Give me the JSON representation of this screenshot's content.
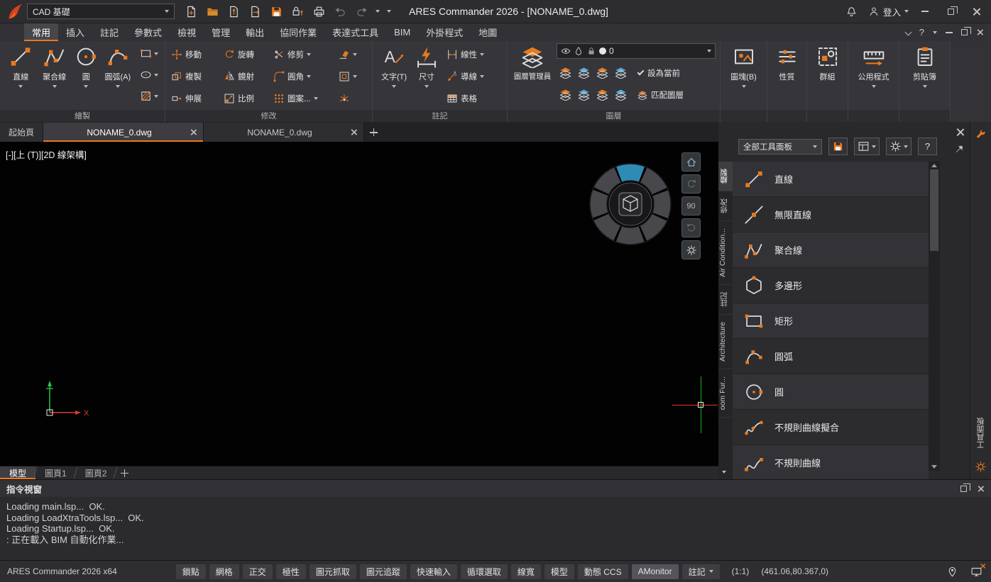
{
  "titlebar": {
    "workspace": "CAD 基礎",
    "title": "ARES Commander 2026 - [NONAME_0.dwg]",
    "login": "登入"
  },
  "menubar": {
    "tabs": [
      "常用",
      "插入",
      "註記",
      "參數式",
      "檢視",
      "管理",
      "輸出",
      "協同作業",
      "表達式工具",
      "BIM",
      "外掛程式",
      "地圖"
    ],
    "help": "?"
  },
  "ribbon": {
    "draw": {
      "label": "繪製",
      "tools": [
        {
          "label": "直線"
        },
        {
          "label": "聚合線"
        },
        {
          "label": "圓"
        },
        {
          "label": "圓弧(A)"
        }
      ]
    },
    "modify": {
      "label": "修改",
      "rows": [
        {
          "c1": "移動",
          "c2": "旋轉",
          "c3": "修剪"
        },
        {
          "c1": "複製",
          "c2": "鏡射",
          "c3": "圓角"
        },
        {
          "c1": "伸展",
          "c2": "比例",
          "c3": "圖案..."
        }
      ]
    },
    "annotation": {
      "label": "註記",
      "text_tool": "文字(T)",
      "dim_tool": "尺寸",
      "side": [
        "線性",
        "導線",
        "表格"
      ]
    },
    "layers": {
      "label": "圖層",
      "manager": "圖層管理員",
      "current_layer": "0",
      "set_current": "設為當前",
      "match_layer": "匹配圖層"
    },
    "big_buttons": [
      {
        "label": "圖塊(B)"
      },
      {
        "label": "性質"
      },
      {
        "label": "群組"
      },
      {
        "label": "公用程式"
      },
      {
        "label": "剪貼簿"
      }
    ]
  },
  "doc_tabs": [
    "起始頁",
    "NONAME_0.dwg",
    "NONAME_0.dwg"
  ],
  "canvas": {
    "viewport_label": "[-][上 (T)][2D 線架構]",
    "rotate_angle": "90",
    "axis_x": "X"
  },
  "layout_tabs": [
    "模型",
    "圖頁1",
    "圖頁2"
  ],
  "palette": {
    "dropdown": "全部工具面板",
    "help": "?",
    "tabs": [
      "繪製",
      "修改",
      "Air Condition...",
      "註記",
      "Architecture",
      "oom Fur..."
    ],
    "items": [
      "直線",
      "無限直線",
      "聚合線",
      "多邊形",
      "矩形",
      "圓弧",
      "圓",
      "不規則曲線擬合",
      "不規則曲線"
    ],
    "side_label": "工具面板"
  },
  "command": {
    "title": "指令視窗",
    "lines": [
      "Loading main.lsp...  OK.",
      "Loading LoadXtraTools.lsp...  OK.",
      "Loading Startup.lsp...  OK.",
      ": 正在載入 BIM 自動化作業..."
    ]
  },
  "statusbar": {
    "app": "ARES Commander 2026 x64",
    "toggles": [
      "鎖點",
      "網格",
      "正交",
      "極性",
      "圖元抓取",
      "圖元追蹤",
      "快速輸入",
      "循環選取",
      "線寬",
      "模型",
      "動態 CCS",
      "AMonitor",
      "註記"
    ],
    "scale": "(1:1)",
    "coords": "(461.06,80.367,0)"
  }
}
